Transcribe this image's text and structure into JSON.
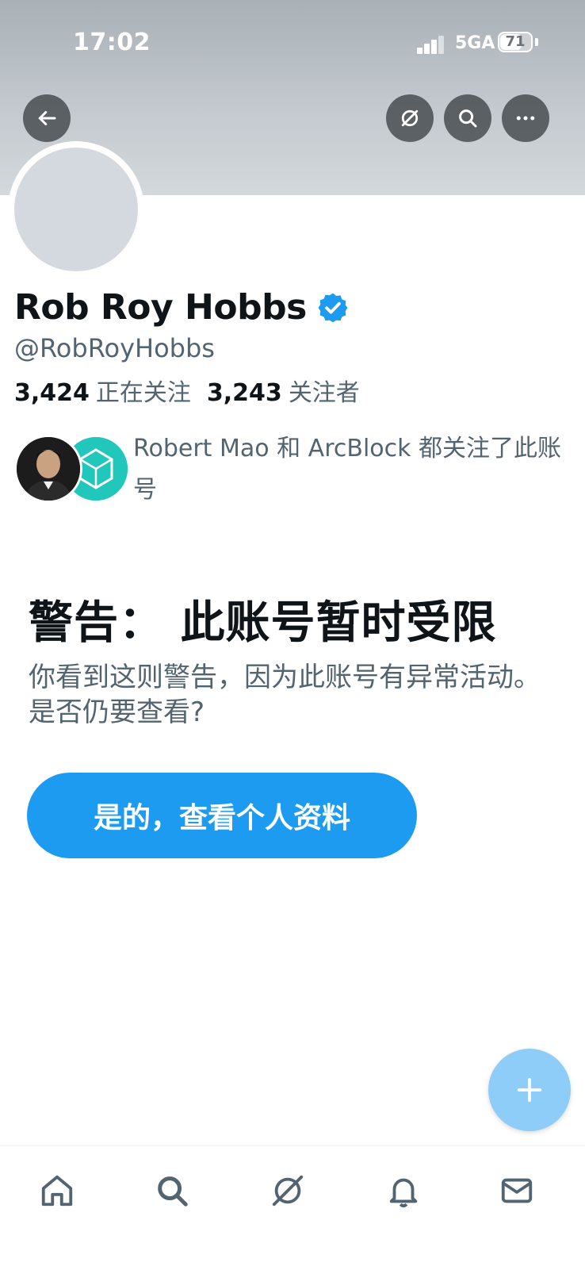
{
  "status_bar": {
    "time": "17:02",
    "network": "5GA",
    "battery": "71",
    "battery_level": 0.71
  },
  "profile": {
    "display_name": "Rob Roy Hobbs",
    "handle": "@RobRoyHobbs",
    "following_count": "3,424",
    "following_label": "正在关注",
    "followers_count": "3,243",
    "followers_label": "关注者",
    "followed_by_text": "Robert Mao 和 ArcBlock 都关注了此账号"
  },
  "warning": {
    "title": "警告：  此账号暂时受限",
    "description": "你看到这则警告，因为此账号有异常活动。是否仍要查看?",
    "button_label": "是的，查看个人资料"
  },
  "colors": {
    "accent": "#1d9bf0",
    "fab": "#8ecdf8",
    "text_secondary": "#536471"
  },
  "icons": {
    "header": [
      "back-arrow-icon",
      "grok-icon",
      "search-icon",
      "more-icon"
    ],
    "tabs": [
      "home-icon",
      "search-icon",
      "grok-icon",
      "notifications-icon",
      "messages-icon"
    ],
    "fab": "plus-icon"
  }
}
